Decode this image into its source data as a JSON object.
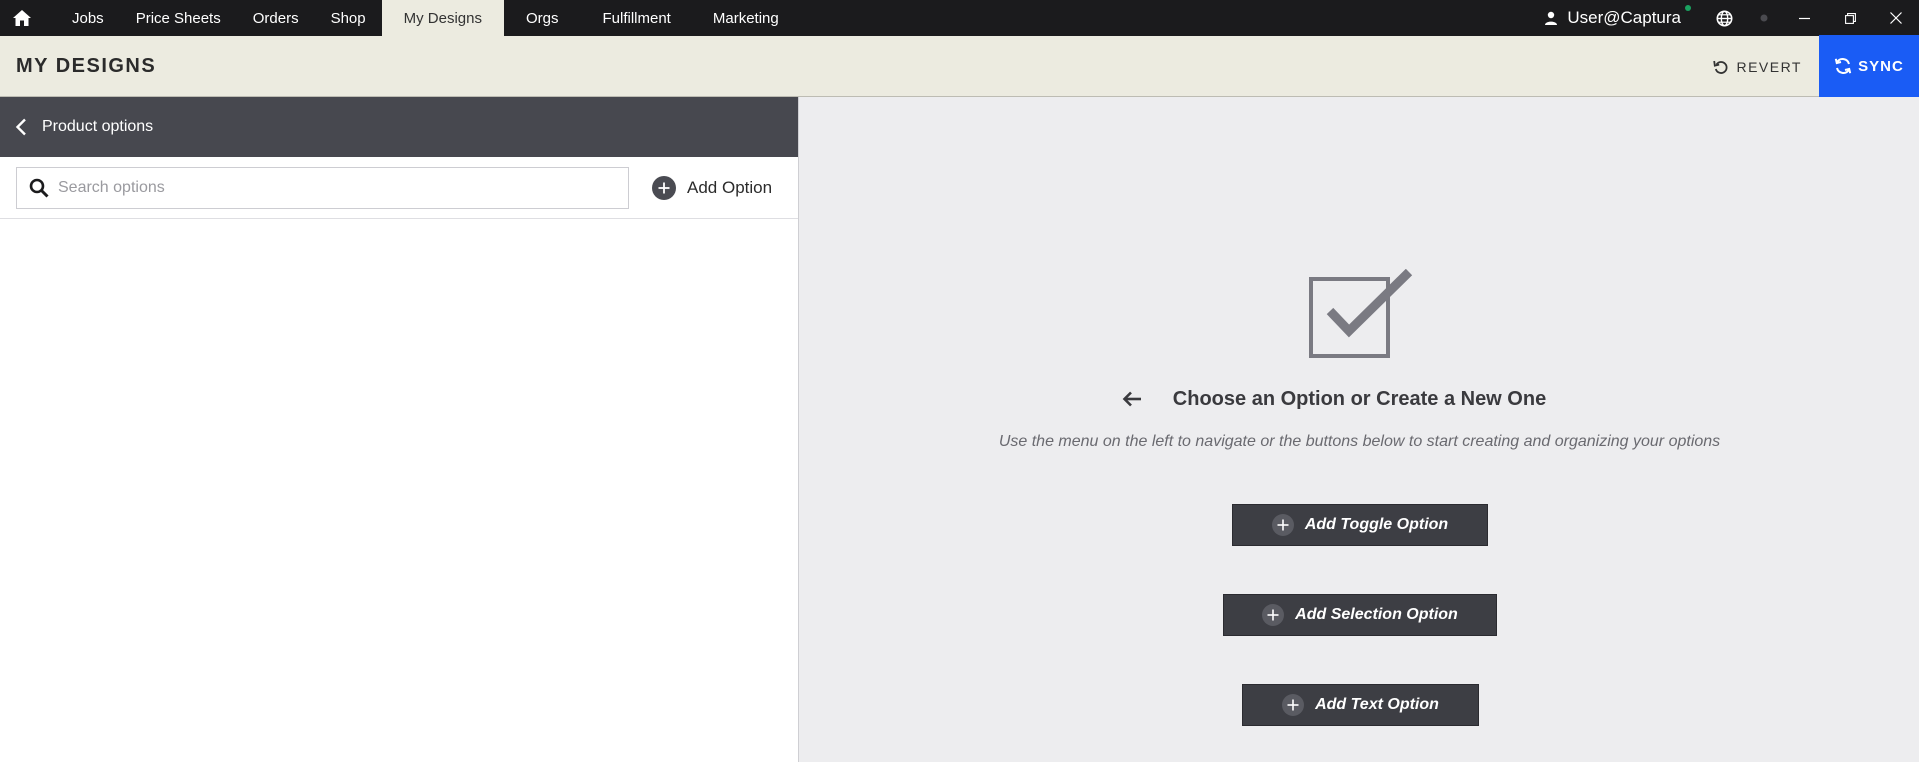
{
  "nav": {
    "tabs": [
      "Jobs",
      "Price Sheets",
      "Orders",
      "Shop",
      "My Designs",
      "Orgs",
      "Fulfillment",
      "Marketing"
    ],
    "active": "My Designs",
    "user": "User@Captura",
    "status_color": "#1aa260"
  },
  "header": {
    "title": "MY DESIGNS",
    "revert_label": "REVERT",
    "sync_label": "SYNC",
    "accent": "#1a5cf5"
  },
  "left_panel": {
    "title": "Product options",
    "search_placeholder": "Search options",
    "add_option_label": "Add Option"
  },
  "empty_state": {
    "heading": "Choose an Option or Create a New One",
    "hint": "Use the menu on the left to navigate or the buttons below to start creating and organizing your options",
    "buttons": [
      "Add Toggle Option",
      "Add Selection Option",
      "Add Text Option"
    ]
  }
}
